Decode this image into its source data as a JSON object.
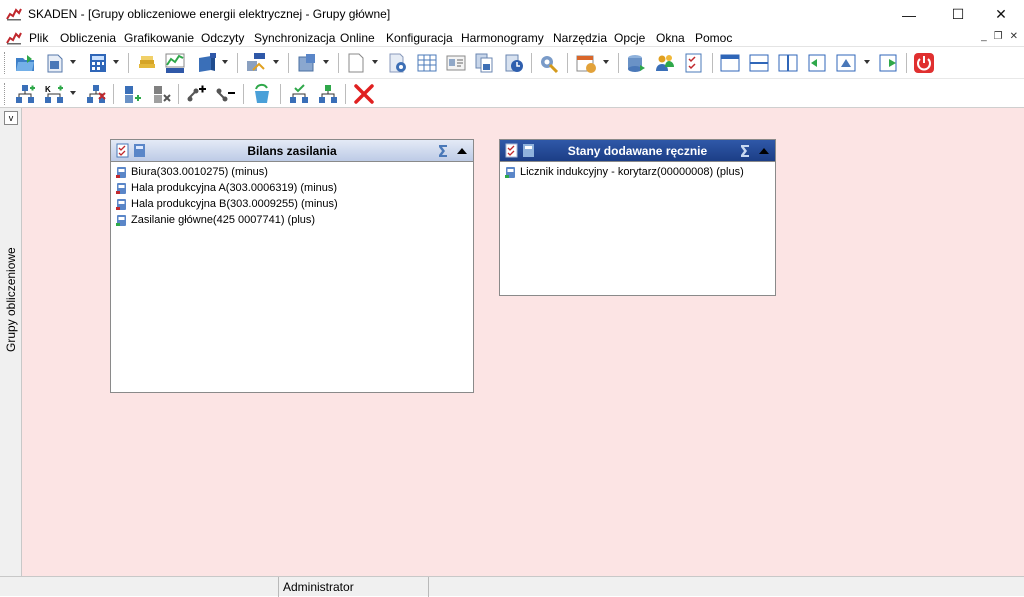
{
  "window": {
    "title": "SKADEN - [Grupy obliczeniowe energii elektrycznej - Grupy główne]",
    "minimize": "—",
    "maximize": "☐",
    "close": "✕"
  },
  "menu": [
    {
      "label": "Plik"
    },
    {
      "label": "Obliczenia"
    },
    {
      "label": "Grafikowanie"
    },
    {
      "label": "Odczyty"
    },
    {
      "label": "Synchronizacja"
    },
    {
      "label": "Online"
    },
    {
      "label": "Konfiguracja"
    },
    {
      "label": "Harmonogramy"
    },
    {
      "label": "Narzędzia"
    },
    {
      "label": "Opcje"
    },
    {
      "label": "Okna"
    },
    {
      "label": "Pomoc"
    }
  ],
  "mdi_controls": {
    "minimize": "_",
    "restore": "❐",
    "close": "✕"
  },
  "sidebar": {
    "toggle": "v",
    "label": "Grupy obliczeniowe"
  },
  "panels": {
    "bilans": {
      "title": "Bilans zasilania",
      "items": [
        {
          "label": "Biura(303.0010275) (minus)",
          "icon": "meter-icon"
        },
        {
          "label": "Hala produkcyjna A(303.0006319) (minus)",
          "icon": "meter-icon"
        },
        {
          "label": "Hala produkcyjna B(303.0009255) (minus)",
          "icon": "meter-icon"
        },
        {
          "label": "Zasilanie główne(425 0007741) (plus)",
          "icon": "meter-green-icon"
        }
      ]
    },
    "stany": {
      "title": "Stany dodawane ręcznie",
      "items": [
        {
          "label": "Licznik indukcyjny - korytarz(00000008) (plus)",
          "icon": "meter-green-icon"
        }
      ]
    }
  },
  "status": {
    "user": "Administrator"
  },
  "colors": {
    "workspace": "#fce4e4",
    "panel_header_light": "#c9d5ec",
    "panel_header_dark": "#24479a"
  }
}
